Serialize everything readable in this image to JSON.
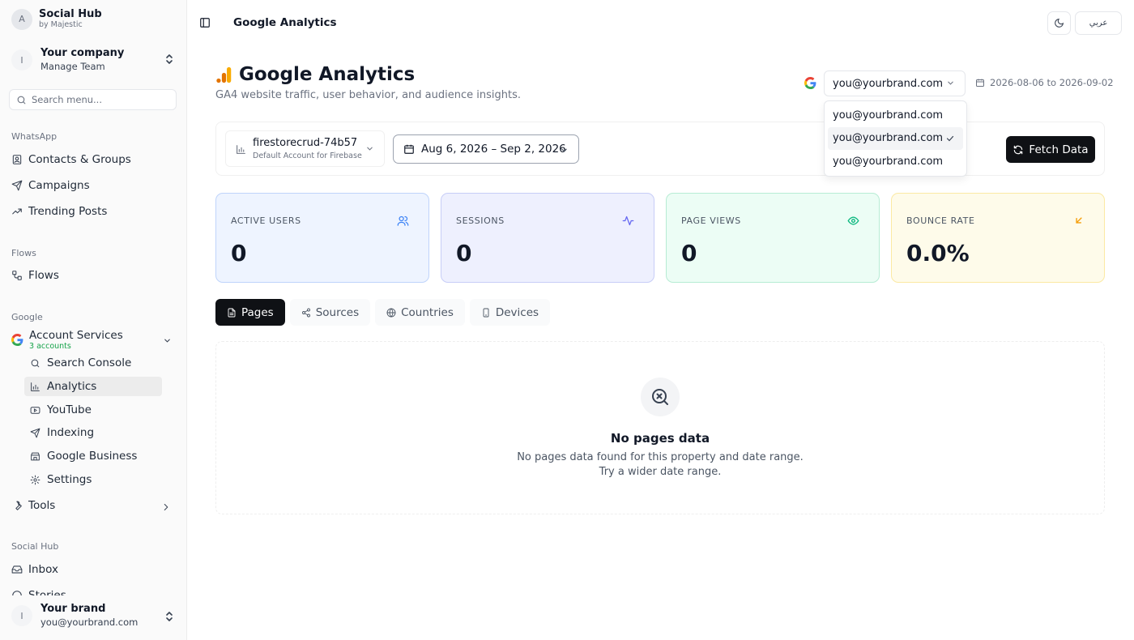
{
  "app": {
    "title": "Social Hub",
    "subtitle": "by Majestic",
    "avatar_initial": "A"
  },
  "company": {
    "initial": "I",
    "name": "Your company",
    "sub": "Manage Team"
  },
  "search": {
    "placeholder": "Search menu..."
  },
  "sidebar": {
    "whatsapp_label": "WhatsApp",
    "whatsapp_items": [
      "Contacts & Groups",
      "Campaigns",
      "Trending Posts"
    ],
    "flows_label": "Flows",
    "flows_items": [
      "Flows"
    ],
    "google_label": "Google",
    "account_services": {
      "title": "Account Services",
      "sub": "3 accounts"
    },
    "google_items": [
      "Search Console",
      "Analytics",
      "YouTube",
      "Indexing",
      "Google Business",
      "Settings"
    ],
    "active_item": "Analytics",
    "tools": "Tools",
    "social_label": "Social Hub",
    "social_items": [
      "Inbox",
      "Stories"
    ]
  },
  "user": {
    "initial": "I",
    "name": "Your brand",
    "email": "you@yourbrand.com"
  },
  "topbar": {
    "title": "Google Analytics",
    "lang": "عربي"
  },
  "header": {
    "title": "Google Analytics",
    "subtitle": "GA4 website traffic, user behavior, and audience insights.",
    "account_selected": "you@yourbrand.com",
    "date_range": "2026-08-06 to 2026-09-02"
  },
  "dropdown": {
    "options": [
      "you@yourbrand.com",
      "you@yourbrand.com",
      "you@yourbrand.com"
    ],
    "selected_index": 1
  },
  "filters": {
    "property_name": "firestorecrud-74b57",
    "property_sub": "Default Account for Firebase",
    "date_button": "Aug 6, 2026 – Sep 2, 2026",
    "fetch_label": "Fetch Data"
  },
  "stats": [
    {
      "label": "ACTIVE USERS",
      "value": "0",
      "icon": "users-icon",
      "bg": "#eef4ff",
      "border": "#bfd4fb",
      "accent": "#3b82f6"
    },
    {
      "label": "SESSIONS",
      "value": "0",
      "icon": "activity-icon",
      "bg": "#eef0fe",
      "border": "#c7cdf7",
      "accent": "#6366f1"
    },
    {
      "label": "PAGE VIEWS",
      "value": "0",
      "icon": "eye-icon",
      "bg": "#ecfdf5",
      "border": "#b7ecd4",
      "accent": "#10b981"
    },
    {
      "label": "BOUNCE RATE",
      "value": "0.0%",
      "icon": "arrow-down-left-icon",
      "bg": "#fefbea",
      "border": "#fbe9a3",
      "accent": "#f59e0b"
    }
  ],
  "tabs": [
    "Pages",
    "Sources",
    "Countries",
    "Devices"
  ],
  "active_tab": "Pages",
  "empty": {
    "title": "No pages data",
    "line1": "No pages data found for this property and date range.",
    "line2": "Try a wider date range."
  }
}
